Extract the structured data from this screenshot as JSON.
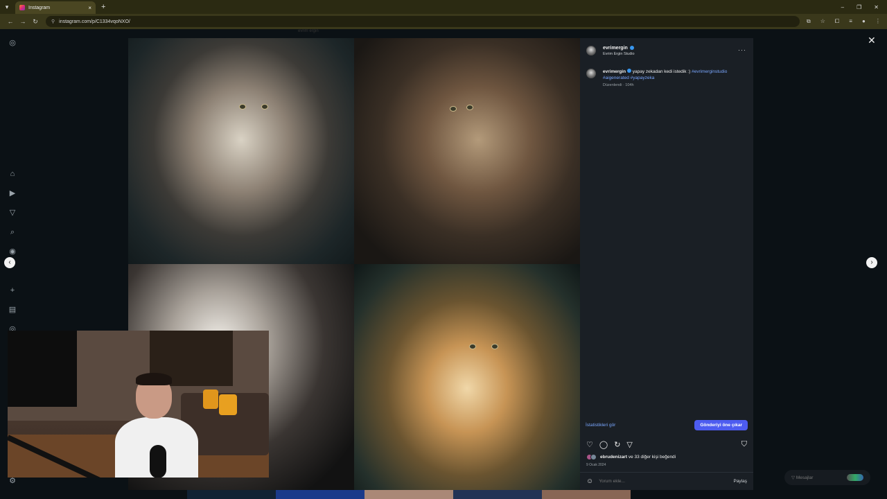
{
  "browser": {
    "tab_title": "Instagram",
    "url": "instagram.com/p/C1334vqoNXO/",
    "new_tab": "+",
    "tab_close": "×",
    "win_min": "–",
    "win_restore": "❐",
    "win_close": "✕"
  },
  "overlay_top_text": "evrim ergin",
  "post": {
    "author": "evrimergin",
    "author_subtitle": "Evrim Ergin Studio",
    "caption_user": "evrimergin",
    "caption_text": " yapay zekadan kedi istedik :) ",
    "caption_tags": [
      "#evrimerginstudio",
      "#aigenerated",
      "#yapayzeka"
    ],
    "edited_meta": "Düzenlendi · 104h",
    "stats_link": "İstatistikleri gör",
    "promote_button": "Gönderiyi öne çıkar",
    "likes_user": "ebrudenizart",
    "likes_rest": " ve 33 diğer kişi beğendi",
    "date": "9 Ocak 2024",
    "comment_placeholder": "Yorum ekle...",
    "share_label": "Paylaş",
    "more": "···"
  },
  "messages_label": "Mesajlar",
  "icons": {
    "instagram": "◎",
    "home": "⌂",
    "reels": "▶",
    "send": "▽",
    "search": "⌕",
    "explore": "◉",
    "heart": "♡",
    "create": "+",
    "dashboard": "▤",
    "profile": "◎",
    "settings": "⚙",
    "close": "✕",
    "prev": "‹",
    "next": "›",
    "like": "♡",
    "comment": "◯",
    "repost": "↻",
    "share_send": "▽",
    "save": "⛉",
    "emoji": "☺"
  }
}
